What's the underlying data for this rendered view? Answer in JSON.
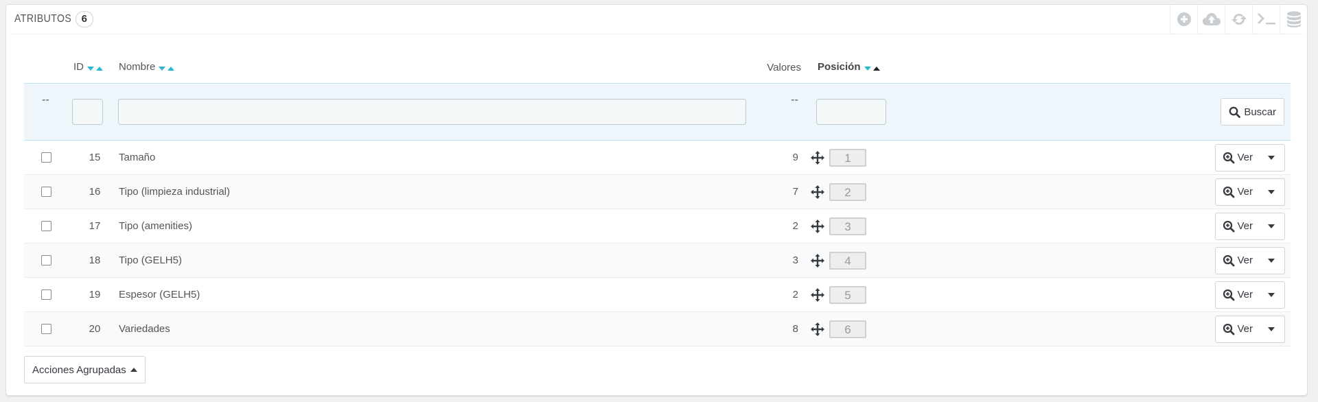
{
  "header": {
    "title": "ATRIBUTOS",
    "count": "6"
  },
  "toolbar": {
    "icons": [
      "plus-circle-icon",
      "cloud-upload-icon",
      "refresh-icon",
      "terminal-icon",
      "database-icon"
    ]
  },
  "columns": {
    "id": "ID",
    "name": "Nombre",
    "values": "Valores",
    "position": "Posición"
  },
  "filters": {
    "checkbox_placeholder": "--",
    "values_placeholder": "--",
    "search_label": "Buscar"
  },
  "rows": [
    {
      "id": "15",
      "name": "Tamaño",
      "values": "9",
      "position": "1"
    },
    {
      "id": "16",
      "name": "Tipo (limpieza industrial)",
      "values": "7",
      "position": "2"
    },
    {
      "id": "17",
      "name": "Tipo (amenities)",
      "values": "2",
      "position": "3"
    },
    {
      "id": "18",
      "name": "Tipo (GELH5)",
      "values": "3",
      "position": "4"
    },
    {
      "id": "19",
      "name": "Espesor (GELH5)",
      "values": "2",
      "position": "5"
    },
    {
      "id": "20",
      "name": "Variedades",
      "values": "8",
      "position": "6"
    }
  ],
  "row_action": {
    "label": "Ver"
  },
  "bulk_actions": {
    "label": "Acciones Agrupadas"
  },
  "colors": {
    "accent": "#25b9d7",
    "filter_bg": "#eef6fb"
  }
}
